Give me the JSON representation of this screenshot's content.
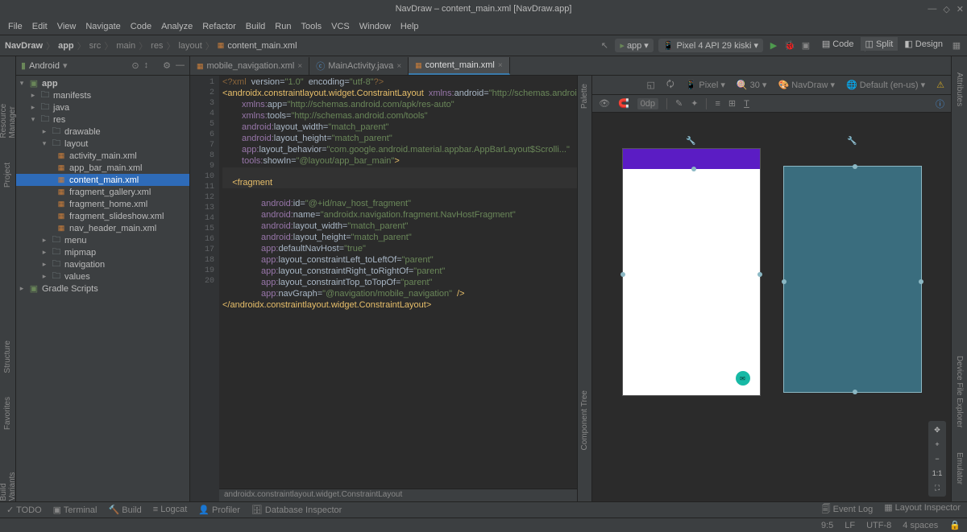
{
  "window": {
    "title": "NavDraw – content_main.xml [NavDraw.app]"
  },
  "menu": [
    "File",
    "Edit",
    "View",
    "Navigate",
    "Code",
    "Analyze",
    "Refactor",
    "Build",
    "Run",
    "Tools",
    "VCS",
    "Window",
    "Help"
  ],
  "breadcrumb": [
    "NavDraw",
    "app",
    "src",
    "main",
    "res",
    "layout",
    "content_main.xml"
  ],
  "run_config": "app",
  "device": "Pixel 4 API 29 kiski",
  "project_view": "Android",
  "tree": {
    "root": "app",
    "manifests": "manifests",
    "java": "java",
    "res": "res",
    "drawable": "drawable",
    "layout": "layout",
    "layout_files": [
      "activity_main.xml",
      "app_bar_main.xml",
      "content_main.xml",
      "fragment_gallery.xml",
      "fragment_home.xml",
      "fragment_slideshow.xml",
      "nav_header_main.xml"
    ],
    "menu": "menu",
    "mipmap": "mipmap",
    "navigation": "navigation",
    "values": "values",
    "gradle": "Gradle Scripts"
  },
  "tabs": [
    {
      "label": "mobile_navigation.xml",
      "type": "xml"
    },
    {
      "label": "MainActivity.java",
      "type": "java"
    },
    {
      "label": "content_main.xml",
      "type": "xml",
      "active": true
    }
  ],
  "design_modes": {
    "code": "Code",
    "split": "Split",
    "design": "Design",
    "active": "Split"
  },
  "design_header": {
    "pixel": "Pixel",
    "zoom": "30",
    "theme": "NavDraw",
    "locale": "Default (en-us)"
  },
  "design_toolbar": {
    "dp": "0dp"
  },
  "code_lines": 20,
  "code": {
    "l1": "<?xml version=\"1.0\" encoding=\"utf-8\"?>",
    "l2a": "<androidx.constraintlayout.widget.ConstraintLayout",
    "l2b": "xmlns:android=\"http://schemas.android.com/apk/res",
    "l3": "xmlns:app=\"http://schemas.android.com/apk/res-auto\"",
    "l4": "xmlns:tools=\"http://schemas.android.com/tools\"",
    "l5": "android:layout_width=\"match_parent\"",
    "l6": "android:layout_height=\"match_parent\"",
    "l7": "app:layout_behavior=\"com.google.android.material.appbar.AppBarLayout$Scrolli...\"",
    "l8": "tools:showIn=\"@layout/app_bar_main\">",
    "l10": "<fragment",
    "l11": "android:id=\"@+id/nav_host_fragment\"",
    "l12": "android:name=\"androidx.navigation.fragment.NavHostFragment\"",
    "l13": "android:layout_width=\"match_parent\"",
    "l14": "android:layout_height=\"match_parent\"",
    "l15": "app:defaultNavHost=\"true\"",
    "l16": "app:layout_constraintLeft_toLeftOf=\"parent\"",
    "l17": "app:layout_constraintRight_toRightOf=\"parent\"",
    "l18": "app:layout_constraintTop_toTopOf=\"parent\"",
    "l19": "app:navGraph=\"@navigation/mobile_navigation\" />",
    "l20": "</androidx.constraintlayout.widget.ConstraintLayout>"
  },
  "code_breadcrumb": "androidx.constraintlayout.widget.ConstraintLayout",
  "left_rail": [
    "Resource Manager",
    "Project",
    "Structure",
    "Favorites",
    "Build Variants"
  ],
  "right_rail": [
    "Attributes",
    "Device File Explorer",
    "Emulator"
  ],
  "palette_rail": [
    "Palette",
    "Component Tree"
  ],
  "bottom": {
    "todo": "TODO",
    "terminal": "Terminal",
    "build": "Build",
    "logcat": "Logcat",
    "profiler": "Profiler",
    "db": "Database Inspector",
    "event": "Event Log",
    "layout": "Layout Inspector"
  },
  "status": {
    "pos": "9:5",
    "le": "LF",
    "enc": "UTF-8",
    "indent": "4 spaces"
  }
}
